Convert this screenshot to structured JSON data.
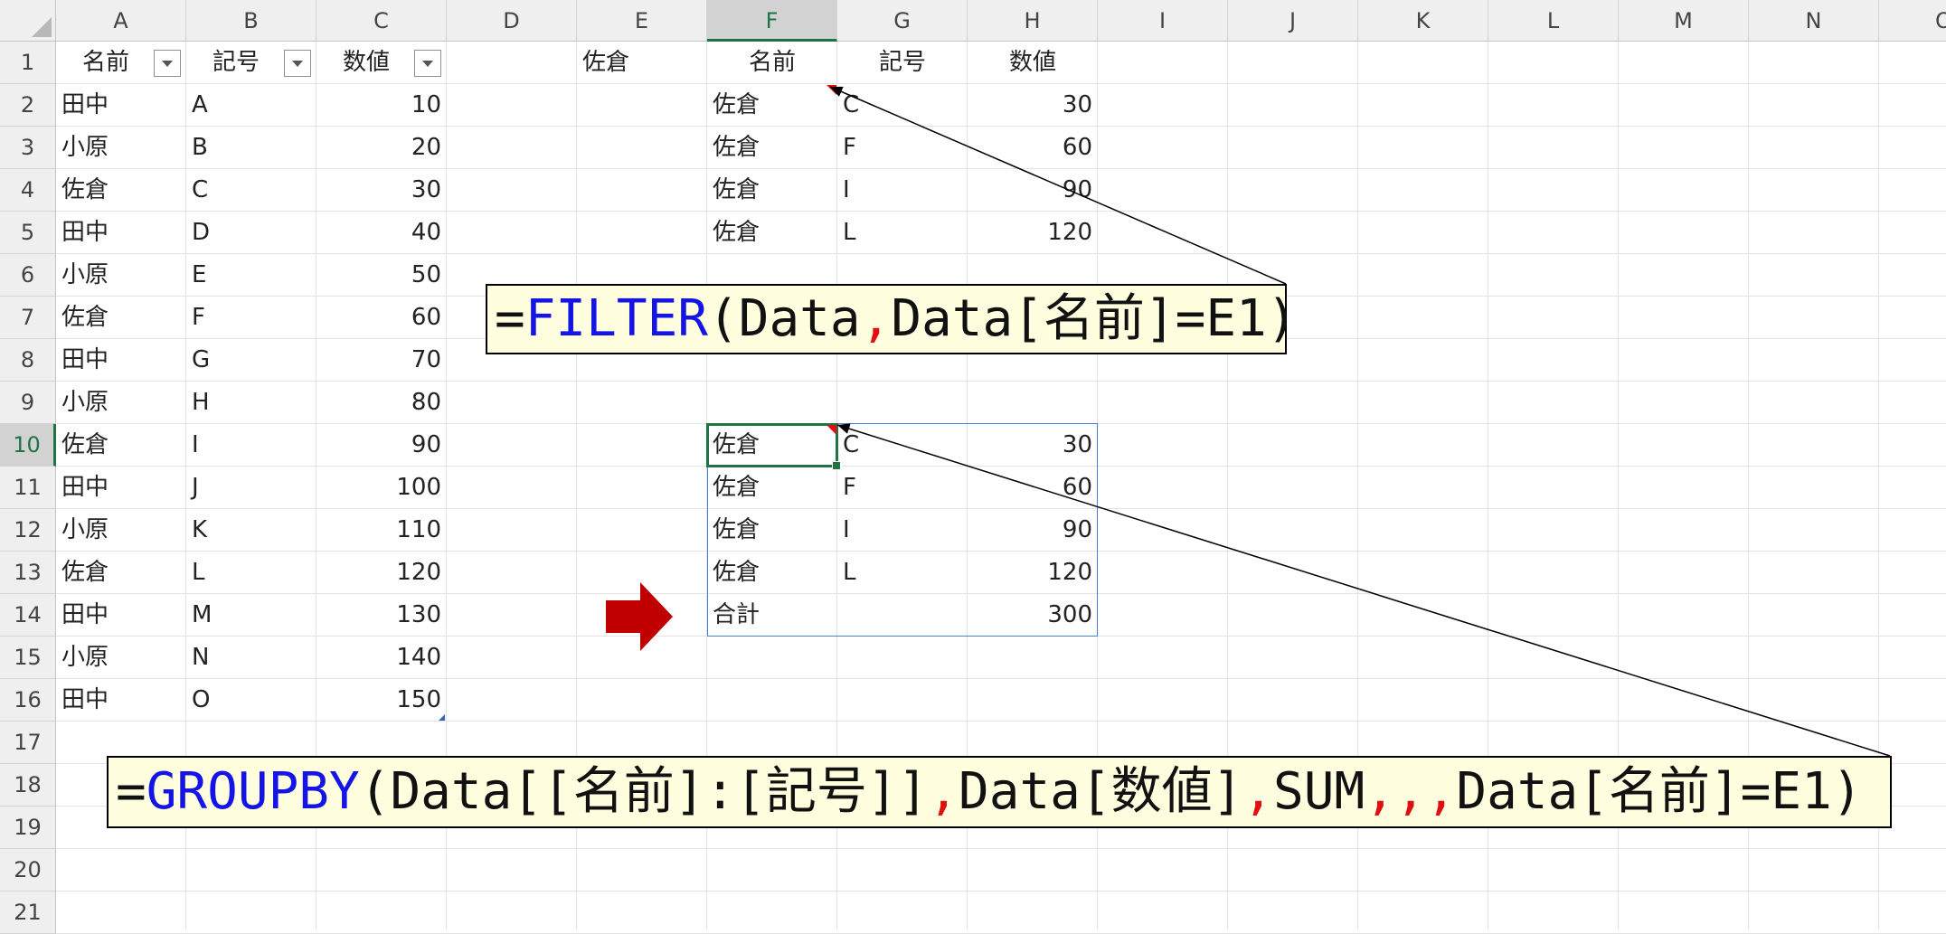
{
  "columns": [
    "A",
    "B",
    "C",
    "D",
    "E",
    "F",
    "G",
    "H",
    "I",
    "J",
    "K",
    "L",
    "M",
    "N",
    "O"
  ],
  "rows": [
    "1",
    "2",
    "3",
    "4",
    "5",
    "6",
    "7",
    "8",
    "9",
    "10",
    "11",
    "12",
    "13",
    "14",
    "15",
    "16",
    "17",
    "18",
    "19",
    "20",
    "21"
  ],
  "selected_column": "F",
  "selected_row": "10",
  "table": {
    "headers": [
      "名前",
      "記号",
      "数値"
    ],
    "rows": [
      [
        "田中",
        "A",
        "10"
      ],
      [
        "小原",
        "B",
        "20"
      ],
      [
        "佐倉",
        "C",
        "30"
      ],
      [
        "田中",
        "D",
        "40"
      ],
      [
        "小原",
        "E",
        "50"
      ],
      [
        "佐倉",
        "F",
        "60"
      ],
      [
        "田中",
        "G",
        "70"
      ],
      [
        "小原",
        "H",
        "80"
      ],
      [
        "佐倉",
        "I",
        "90"
      ],
      [
        "田中",
        "J",
        "100"
      ],
      [
        "小原",
        "K",
        "110"
      ],
      [
        "佐倉",
        "L",
        "120"
      ],
      [
        "田中",
        "M",
        "130"
      ],
      [
        "小原",
        "N",
        "140"
      ],
      [
        "田中",
        "O",
        "150"
      ]
    ]
  },
  "criteria": {
    "value": "佐倉"
  },
  "filter_result": {
    "headers": [
      "名前",
      "記号",
      "数値"
    ],
    "rows": [
      [
        "佐倉",
        "C",
        "30"
      ],
      [
        "佐倉",
        "F",
        "60"
      ],
      [
        "佐倉",
        "I",
        "90"
      ],
      [
        "佐倉",
        "L",
        "120"
      ]
    ]
  },
  "groupby_result": {
    "rows": [
      [
        "佐倉",
        "C",
        "30"
      ],
      [
        "佐倉",
        "F",
        "60"
      ],
      [
        "佐倉",
        "I",
        "90"
      ],
      [
        "佐倉",
        "L",
        "120"
      ]
    ],
    "total_label": "合計",
    "total_value": "300"
  },
  "formulas": {
    "filter": {
      "eq": "=",
      "fn": "FILTER",
      "args_a": "(Data",
      "comma": ",",
      "args_b": "Data[名前]=E1)"
    },
    "groupby": {
      "eq": "=",
      "fn": "GROUPBY",
      "part1": "(Data[[名前]:[記号]]",
      "comma1": ",",
      "part2": "Data[数値]",
      "comma2": ",",
      "part3": "SUM",
      "commas": ",,,",
      "part4": "Data[名前]=E1)"
    }
  },
  "colors": {
    "function_blue": "#1414e6",
    "comma_red": "#e01010",
    "arrow_red": "#c00000",
    "callout_fill": "#ffffe0",
    "selection_green": "#217346",
    "spill_border": "#4a7ed8"
  }
}
